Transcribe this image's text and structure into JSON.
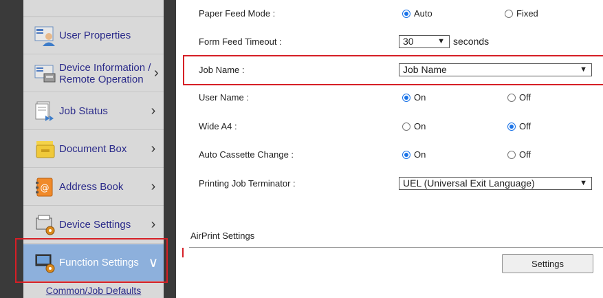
{
  "sidebar": {
    "items": [
      {
        "label": "User Properties",
        "icon": "user-properties-icon",
        "chevron": ""
      },
      {
        "label": "Device Information / Remote Operation",
        "icon": "device-information-icon",
        "chevron": "›"
      },
      {
        "label": "Job Status",
        "icon": "job-status-icon",
        "chevron": "›"
      },
      {
        "label": "Document Box",
        "icon": "document-box-icon",
        "chevron": "›"
      },
      {
        "label": "Address Book",
        "icon": "address-book-icon",
        "chevron": "›"
      },
      {
        "label": "Device Settings",
        "icon": "device-settings-icon",
        "chevron": "›"
      },
      {
        "label": "Function Settings",
        "icon": "function-settings-icon",
        "chevron": "∨",
        "active": true
      }
    ],
    "sub_item": "Common/Job Defaults"
  },
  "form": {
    "paper_feed_mode": {
      "label": "Paper Feed Mode :",
      "options": [
        "Auto",
        "Fixed"
      ],
      "selected": "Auto"
    },
    "form_feed_timeout": {
      "label": "Form Feed Timeout :",
      "value": "30",
      "unit": "seconds"
    },
    "job_name": {
      "label": "Job Name :",
      "value": "Job Name"
    },
    "user_name": {
      "label": "User Name :",
      "options": [
        "On",
        "Off"
      ],
      "selected": "On"
    },
    "wide_a4": {
      "label": "Wide A4 :",
      "options": [
        "On",
        "Off"
      ],
      "selected": "Off"
    },
    "auto_cassette_change": {
      "label": "Auto Cassette Change :",
      "options": [
        "On",
        "Off"
      ],
      "selected": "On"
    },
    "printing_job_terminator": {
      "label": "Printing Job Terminator :",
      "value": "UEL (Universal Exit Language)"
    }
  },
  "airprint": {
    "heading": "AirPrint Settings",
    "button": "Settings"
  },
  "colors": {
    "active_nav": "#8db0dc",
    "highlight": "#d61f26",
    "radio_on": "#1a73e8"
  }
}
